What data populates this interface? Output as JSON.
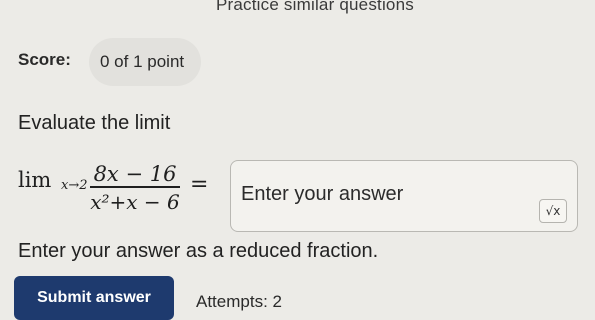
{
  "header": {
    "practice_link": "Practice similar questions"
  },
  "score": {
    "label": "Score:",
    "value": "0 of 1 point"
  },
  "question": {
    "prompt": "Evaluate the limit",
    "limit_word": "lim",
    "limit_subscript": "x→2",
    "numerator": "8x − 16",
    "denominator": "x²+x − 6",
    "equals": "="
  },
  "answer": {
    "placeholder": "Enter your answer",
    "sqrt_button": "√x"
  },
  "hint": "Enter your answer as a reduced fraction.",
  "footer": {
    "submit_label": "Submit answer",
    "attempts": "Attempts: 2"
  }
}
